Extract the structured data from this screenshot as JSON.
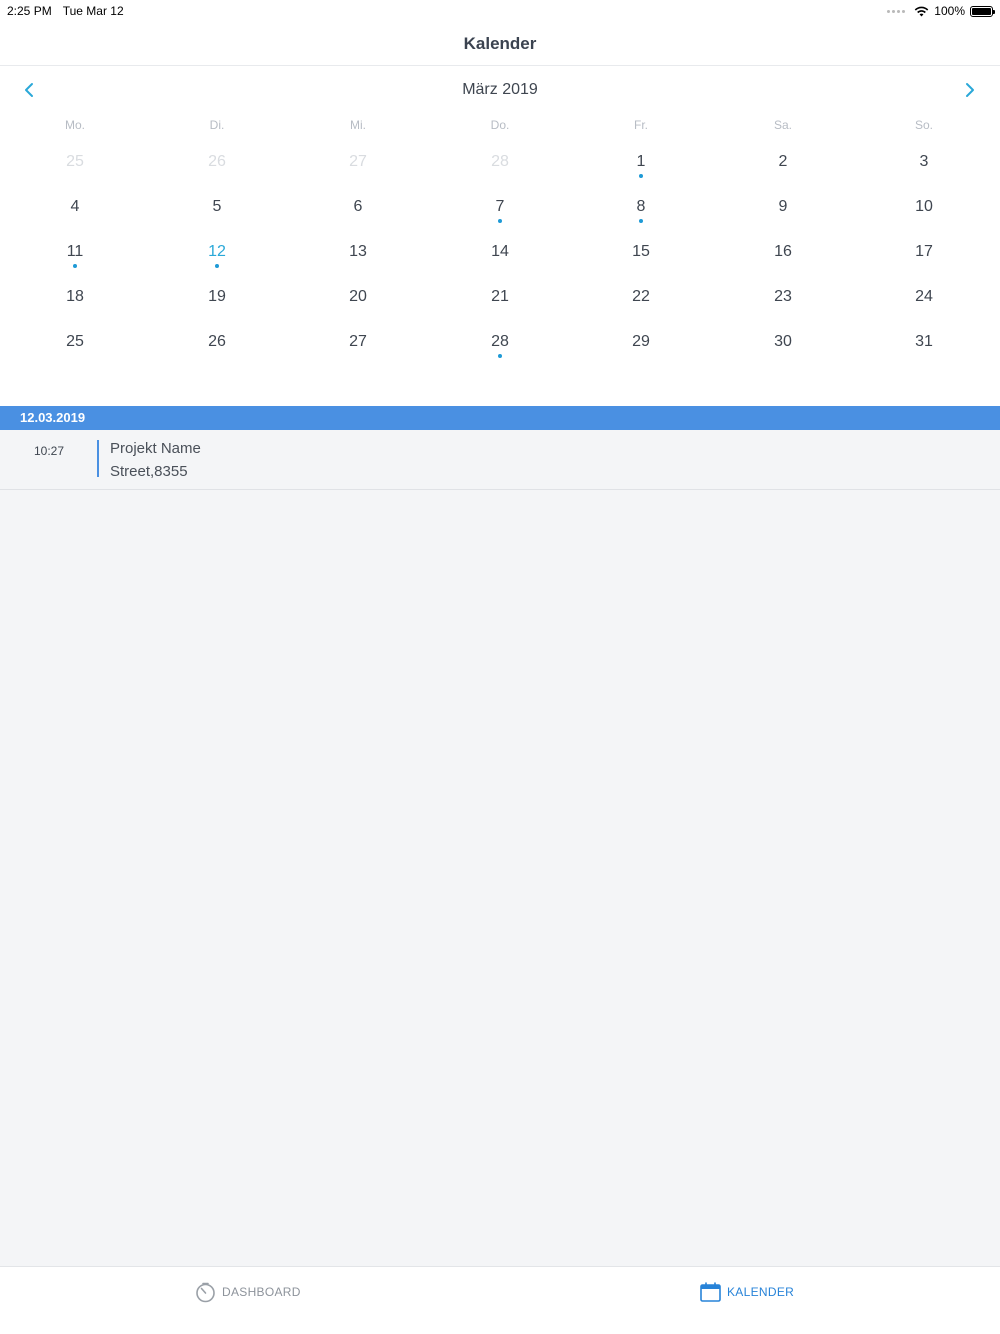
{
  "status_bar": {
    "time": "2:25 PM",
    "date": "Tue Mar 12",
    "battery": "100%"
  },
  "nav": {
    "title": "Kalender"
  },
  "calendar": {
    "month_label": "März 2019",
    "weekdays": [
      "Mo.",
      "Di.",
      "Mi.",
      "Do.",
      "Fr.",
      "Sa.",
      "So."
    ],
    "weeks": [
      [
        {
          "n": "25",
          "o": true
        },
        {
          "n": "26",
          "o": true
        },
        {
          "n": "27",
          "o": true
        },
        {
          "n": "28",
          "o": true
        },
        {
          "n": "1",
          "dot": true
        },
        {
          "n": "2"
        },
        {
          "n": "3"
        }
      ],
      [
        {
          "n": "4"
        },
        {
          "n": "5"
        },
        {
          "n": "6"
        },
        {
          "n": "7",
          "dot": true
        },
        {
          "n": "8",
          "dot": true
        },
        {
          "n": "9"
        },
        {
          "n": "10"
        }
      ],
      [
        {
          "n": "11",
          "dot": true
        },
        {
          "n": "12",
          "dot": true,
          "today": true
        },
        {
          "n": "13"
        },
        {
          "n": "14"
        },
        {
          "n": "15"
        },
        {
          "n": "16"
        },
        {
          "n": "17"
        }
      ],
      [
        {
          "n": "18"
        },
        {
          "n": "19"
        },
        {
          "n": "20"
        },
        {
          "n": "21"
        },
        {
          "n": "22"
        },
        {
          "n": "23"
        },
        {
          "n": "24"
        }
      ],
      [
        {
          "n": "25"
        },
        {
          "n": "26"
        },
        {
          "n": "27"
        },
        {
          "n": "28",
          "dot": true
        },
        {
          "n": "29"
        },
        {
          "n": "30"
        },
        {
          "n": "31"
        }
      ]
    ],
    "colors": {
      "accent": "#2aa8d8",
      "dot": "#1e9ad6",
      "muted": "#d9dce0"
    }
  },
  "selected_date": "12.03.2019",
  "events": [
    {
      "time": "10:27",
      "title": "Projekt Name",
      "subtitle": "Street,8355"
    }
  ],
  "tabs": {
    "dashboard": {
      "label": "DASHBOARD",
      "icon": "timer-icon"
    },
    "kalender": {
      "label": "KALENDER",
      "icon": "calendar-icon",
      "active": true
    }
  },
  "colors": {
    "strip": "#4a90e2",
    "tab_active": "#2783d8",
    "tab_inactive": "#8d939b"
  }
}
